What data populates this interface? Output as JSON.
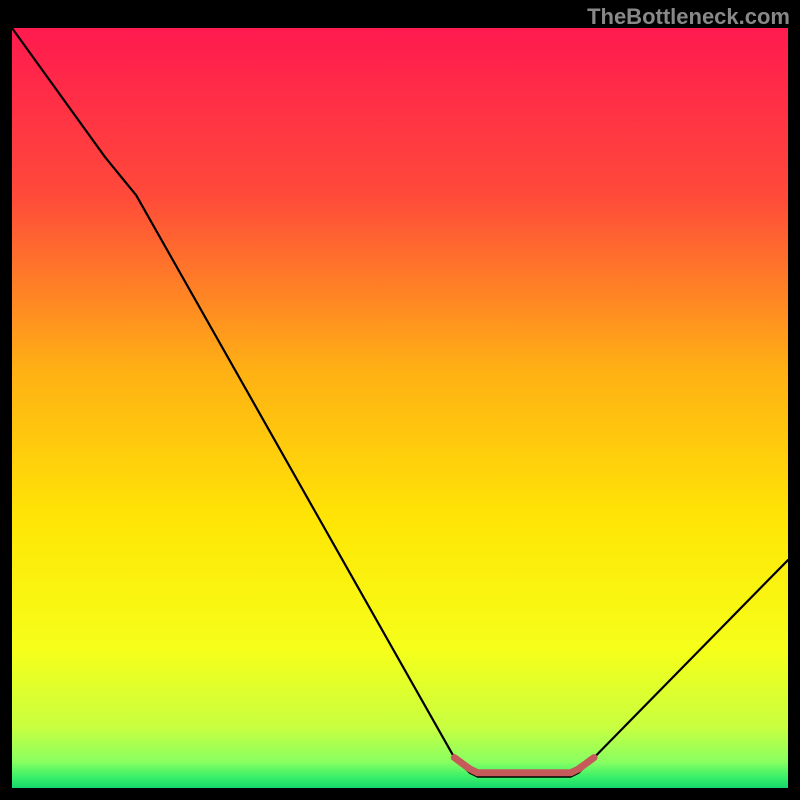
{
  "watermark": "TheBottleneck.com",
  "chart_data": {
    "type": "line",
    "title": "",
    "xlabel": "",
    "ylabel": "",
    "xlim": [
      0,
      100
    ],
    "ylim": [
      0,
      100
    ],
    "gradient_stops": [
      {
        "offset": 0.0,
        "color": "#ff1a4f"
      },
      {
        "offset": 0.22,
        "color": "#ff4a3a"
      },
      {
        "offset": 0.45,
        "color": "#ffb014"
      },
      {
        "offset": 0.65,
        "color": "#ffe605"
      },
      {
        "offset": 0.82,
        "color": "#f5ff1a"
      },
      {
        "offset": 0.92,
        "color": "#c8ff40"
      },
      {
        "offset": 0.965,
        "color": "#8aff60"
      },
      {
        "offset": 0.985,
        "color": "#3cf06a"
      },
      {
        "offset": 1.0,
        "color": "#15d86b"
      }
    ],
    "series": [
      {
        "name": "bottleneck-curve",
        "color": "#000000",
        "width": 2.2,
        "points": [
          {
            "x": 0,
            "y": 100
          },
          {
            "x": 12,
            "y": 83
          },
          {
            "x": 16,
            "y": 78
          },
          {
            "x": 57,
            "y": 4
          },
          {
            "x": 59,
            "y": 2
          },
          {
            "x": 60,
            "y": 1.5
          },
          {
            "x": 72,
            "y": 1.5
          },
          {
            "x": 73,
            "y": 2
          },
          {
            "x": 75,
            "y": 4
          },
          {
            "x": 100,
            "y": 30
          }
        ]
      },
      {
        "name": "bottleneck-flat-highlight",
        "color": "#c65a5a",
        "width": 7,
        "points": [
          {
            "x": 57,
            "y": 4.0
          },
          {
            "x": 59,
            "y": 2.5
          },
          {
            "x": 60,
            "y": 2.0
          },
          {
            "x": 72,
            "y": 2.0
          },
          {
            "x": 73,
            "y": 2.5
          },
          {
            "x": 75,
            "y": 4.0
          }
        ]
      }
    ]
  }
}
